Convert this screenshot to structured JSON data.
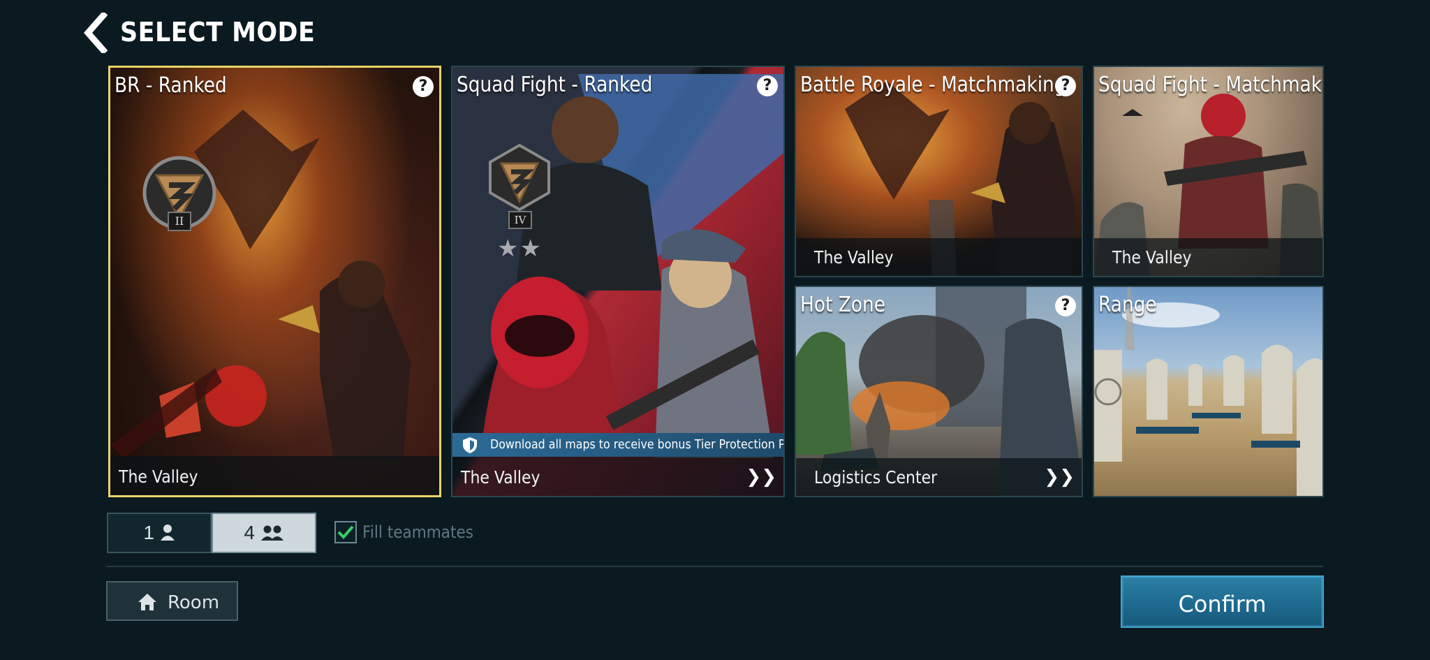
{
  "header": {
    "title": "SELECT MODE"
  },
  "modes": [
    {
      "title": "BR - Ranked",
      "map": "The Valley",
      "help": "?",
      "rank_tier": "II",
      "selected": true
    },
    {
      "title": "Squad Fight - Ranked",
      "map": "The Valley",
      "help": "?",
      "rank_tier": "IV",
      "stars": "★★",
      "notice": "Download all maps to receive bonus Tier Protection Po",
      "chevron": "❯❯"
    },
    {
      "title": "Battle Royale - Matchmaking",
      "map": "The Valley",
      "help": "?"
    },
    {
      "title": "Squad Fight - Matchmaking",
      "map": "The Valley"
    },
    {
      "title": "Hot Zone",
      "map": "Logistics Center",
      "help": "?",
      "chevron": "❯❯"
    },
    {
      "title": "Range"
    }
  ],
  "team": {
    "solo_label": "1",
    "squad_label": "4",
    "selected": "4",
    "fill_label": "Fill teammates",
    "fill_checked": true
  },
  "footer": {
    "room_label": "Room",
    "confirm_label": "Confirm"
  },
  "colors": {
    "background": "#0b1a20",
    "selected_border": "#e9d36a",
    "confirm": "#1e6a8f",
    "checkmark": "#39d06a"
  },
  "icons": [
    "back-arrow-icon",
    "help-icon",
    "shield-icon",
    "chevron-icon",
    "person-icon",
    "group-icon",
    "check-icon",
    "home-icon",
    "star-icon"
  ]
}
